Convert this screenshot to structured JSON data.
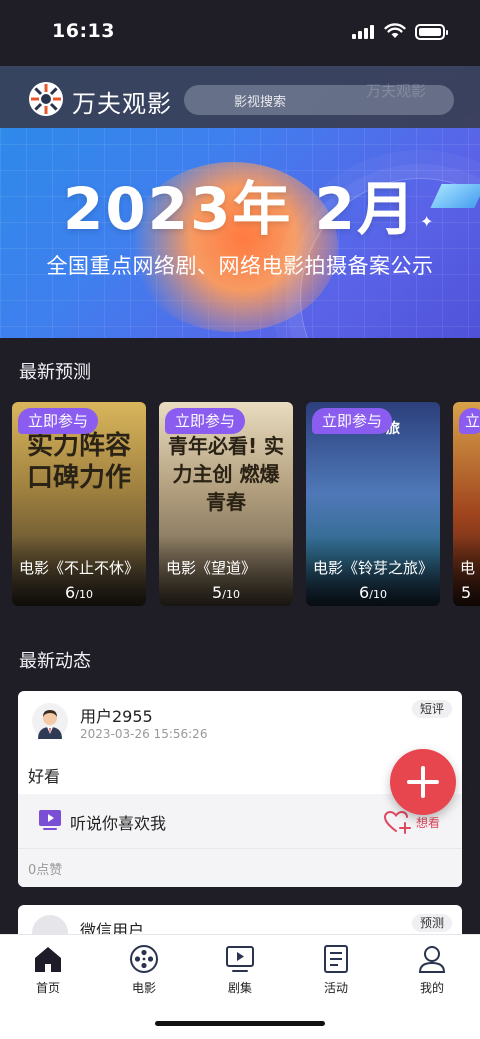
{
  "status_bar": {
    "time": "16:13"
  },
  "header": {
    "logo_text": "万夫观影",
    "search_placeholder": "影视搜索",
    "ghost_logo": "万夫观影"
  },
  "banner": {
    "title": "2023年 2月",
    "subtitle": "全国重点网络剧、网络电影拍摄备案公示"
  },
  "sections": {
    "predictions_title": "最新预测",
    "feed_title": "最新动态"
  },
  "predictions": [
    {
      "badge": "立即参与",
      "poster_text": "实力阵容 口碑力作",
      "name": "电影《不止不休》",
      "score": "6",
      "score_total": "/10",
      "accent": "#c9a545"
    },
    {
      "badge": "立即参与",
      "poster_text": "青年必看! 实力主创 燃爆青春",
      "name": "电影《望道》",
      "score": "5",
      "score_total": "/10",
      "accent": "#8a7a5e"
    },
    {
      "badge": "立即参与",
      "poster_text": "旅",
      "name": "电影《铃芽之旅》",
      "score": "6",
      "score_total": "/10",
      "accent": "#3d5fa8"
    },
    {
      "badge": "立",
      "poster_text": "",
      "name": "电",
      "score": "5",
      "score_total": "",
      "accent": "#a8502c"
    }
  ],
  "feed": [
    {
      "user": "用户2955",
      "time": "2023-03-26 15:56:26",
      "tag": "短评",
      "content": "好看",
      "movie": "听说你喜欢我",
      "want_label": "想看",
      "likes": "0点赞"
    },
    {
      "user": "微信用户",
      "tag": "预测"
    }
  ],
  "tabbar": [
    {
      "label": "首页",
      "icon": "home-icon"
    },
    {
      "label": "电影",
      "icon": "film-reel-icon"
    },
    {
      "label": "剧集",
      "icon": "tv-play-icon"
    },
    {
      "label": "活动",
      "icon": "activity-list-icon"
    },
    {
      "label": "我的",
      "icon": "profile-icon"
    }
  ],
  "colors": {
    "background": "#1f1d26",
    "accent_purple": "#8a5cf0",
    "fab_red": "#e8464f"
  }
}
